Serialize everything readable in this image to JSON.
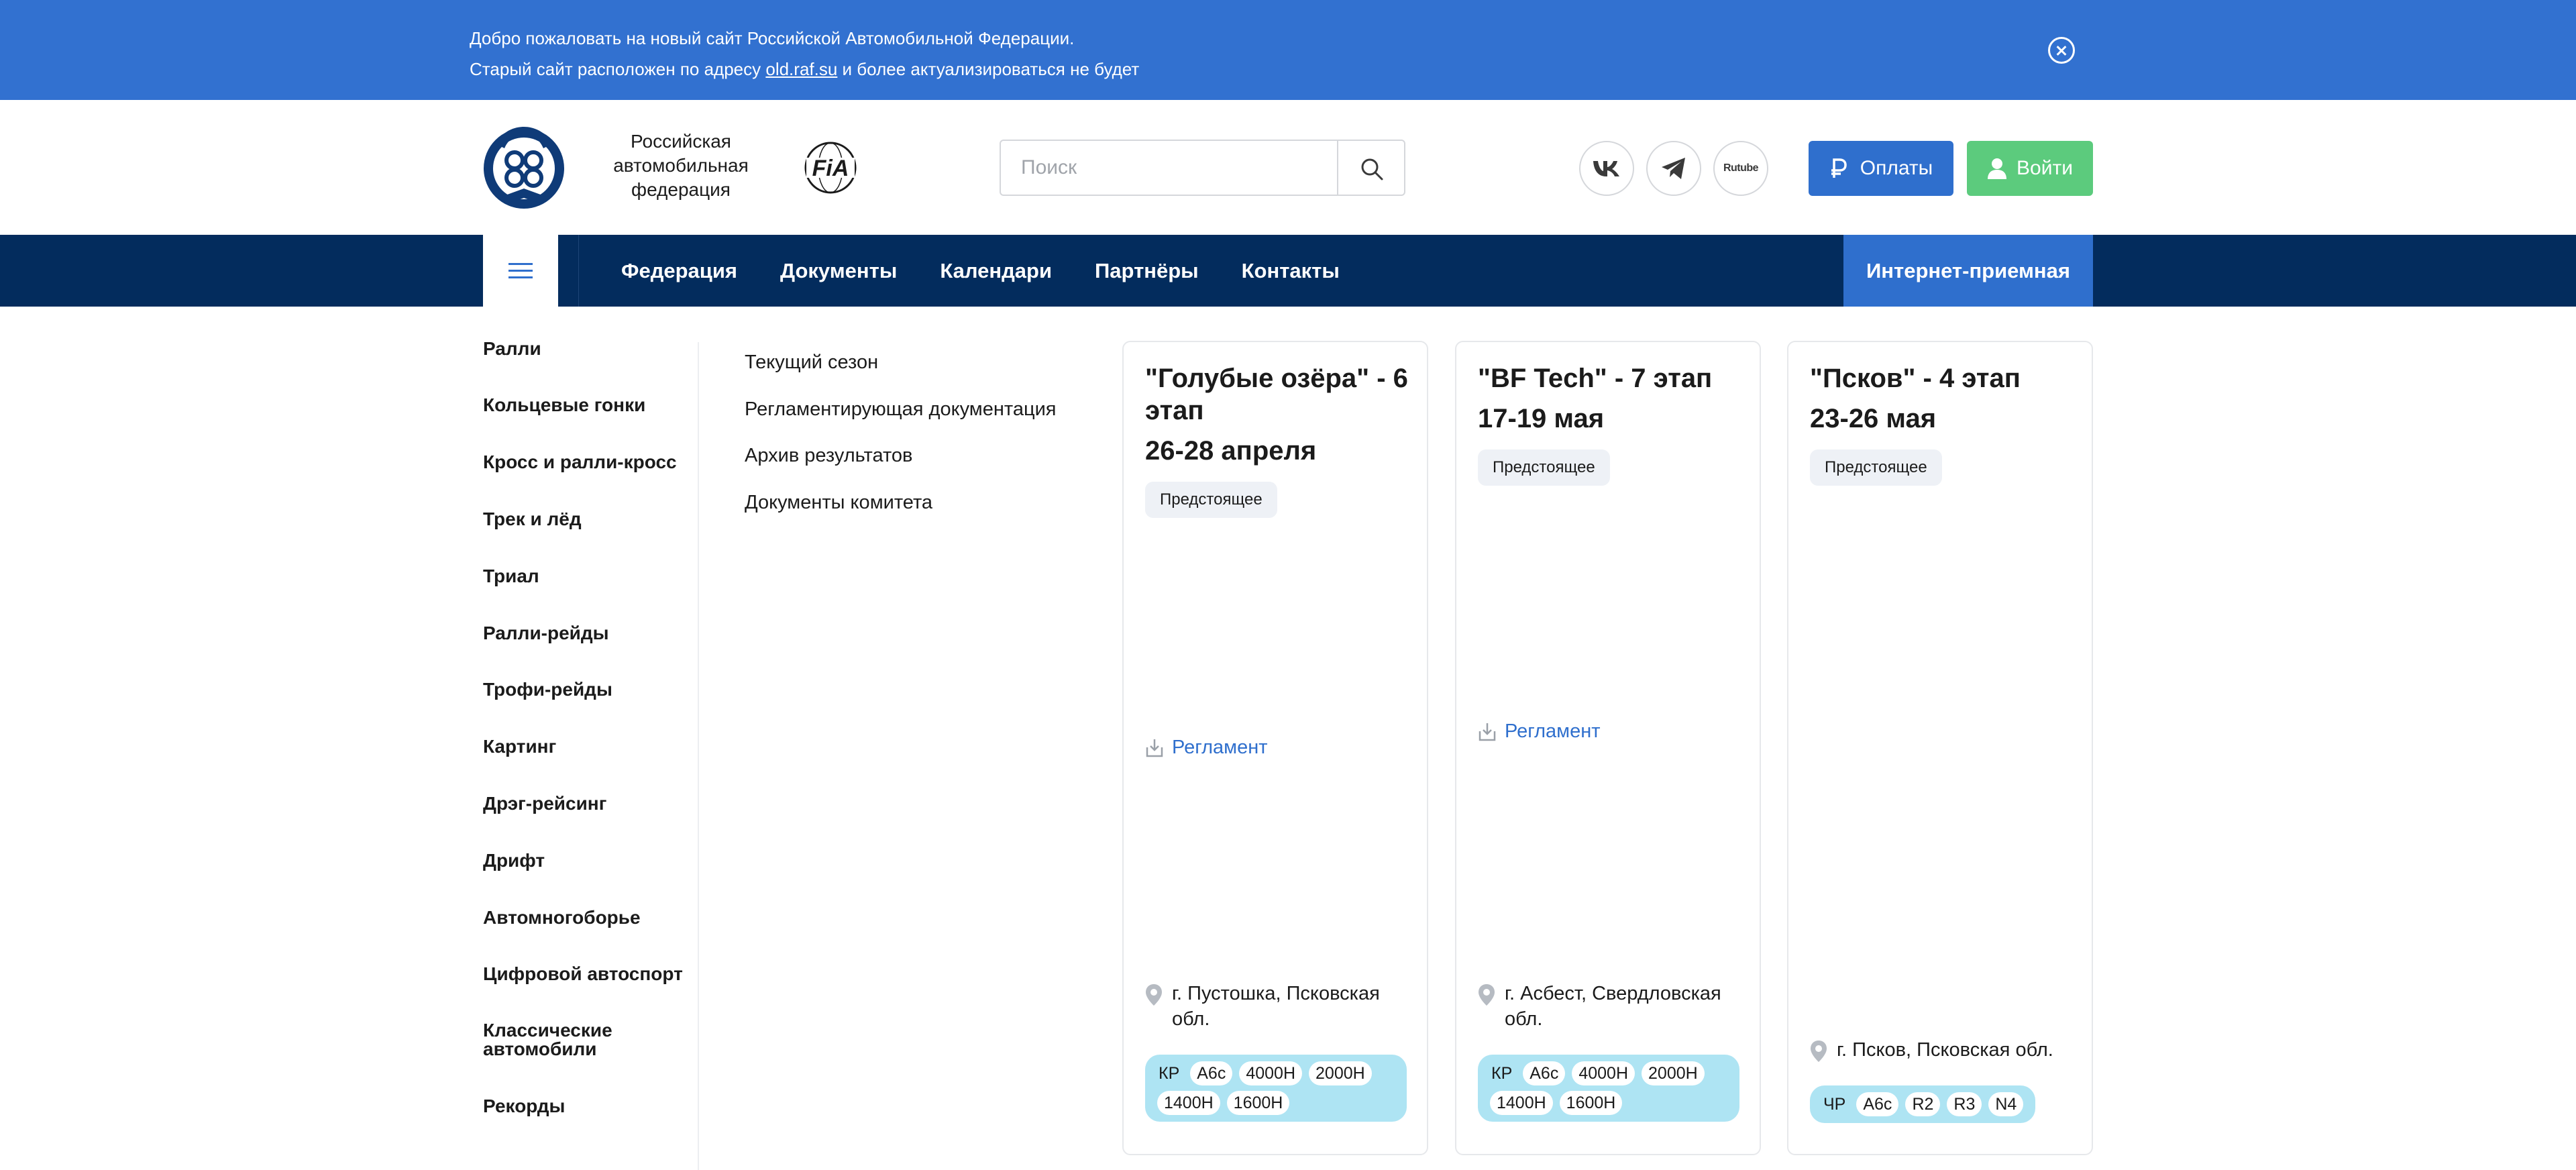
{
  "notice": {
    "line1": "Добро пожаловать на новый сайт Российской Автомобильной Федерации.",
    "line2_before": "Старый сайт расположен по адресу ",
    "line2_link": "old.raf.su",
    "line2_after": " и более актуализироваться не будет"
  },
  "header": {
    "brand_line1": "Российская",
    "brand_line2": "автомобильная",
    "brand_line3": "федерация",
    "search_placeholder": "Поиск",
    "rutube_label": "Rutube",
    "pay_label": "Оплаты",
    "login_label": "Войти",
    "colors": {
      "primary": "#2f6fcd",
      "login": "#5ccb7d",
      "nav": "#032c5d",
      "notice": "#3271d0"
    }
  },
  "nav": {
    "items": [
      "Федерация",
      "Документы",
      "Календари",
      "Партнёры",
      "Контакты"
    ],
    "reception": "Интернет-приемная"
  },
  "sidebar": {
    "items": [
      "Ралли",
      "Кольцевые гонки",
      "Кросс и ралли-кросс",
      "Трек и лёд",
      "Триал",
      "Ралли-рейды",
      "Трофи-рейды",
      "Картинг",
      "Дрэг-рейсинг",
      "Дрифт",
      "Автомногоборье",
      "Цифровой автоспорт",
      "Классические автомобили",
      "Рекорды"
    ]
  },
  "submenu": {
    "items": [
      "Текущий сезон",
      "Регламентирующая документация",
      "Архив результатов",
      "Документы комитета"
    ]
  },
  "cards": [
    {
      "title": "\"Голубые озёра\" - 6 этап",
      "date": "26-28 апреля",
      "status": "Предстоящее",
      "regulation": "Регламент",
      "location": "г. Пустошка, Псковская обл.",
      "tags": [
        "КР",
        "А6с",
        "4000Н",
        "2000Н",
        "1400Н",
        "1600Н"
      ]
    },
    {
      "title": "\"BF Tech\" - 7 этап",
      "date": "17-19 мая",
      "status": "Предстоящее",
      "regulation": "Регламент",
      "location": "г. Асбест, Свердловская обл.",
      "tags": [
        "КР",
        "А6с",
        "4000Н",
        "2000Н",
        "1400Н",
        "1600Н"
      ]
    },
    {
      "title": "\"Псков\" - 4 этап",
      "date": "23-26 мая",
      "status": "Предстоящее",
      "location": "г. Псков, Псковская обл.",
      "tags": [
        "ЧР",
        "А6с",
        "R2",
        "R3",
        "N4"
      ]
    }
  ]
}
